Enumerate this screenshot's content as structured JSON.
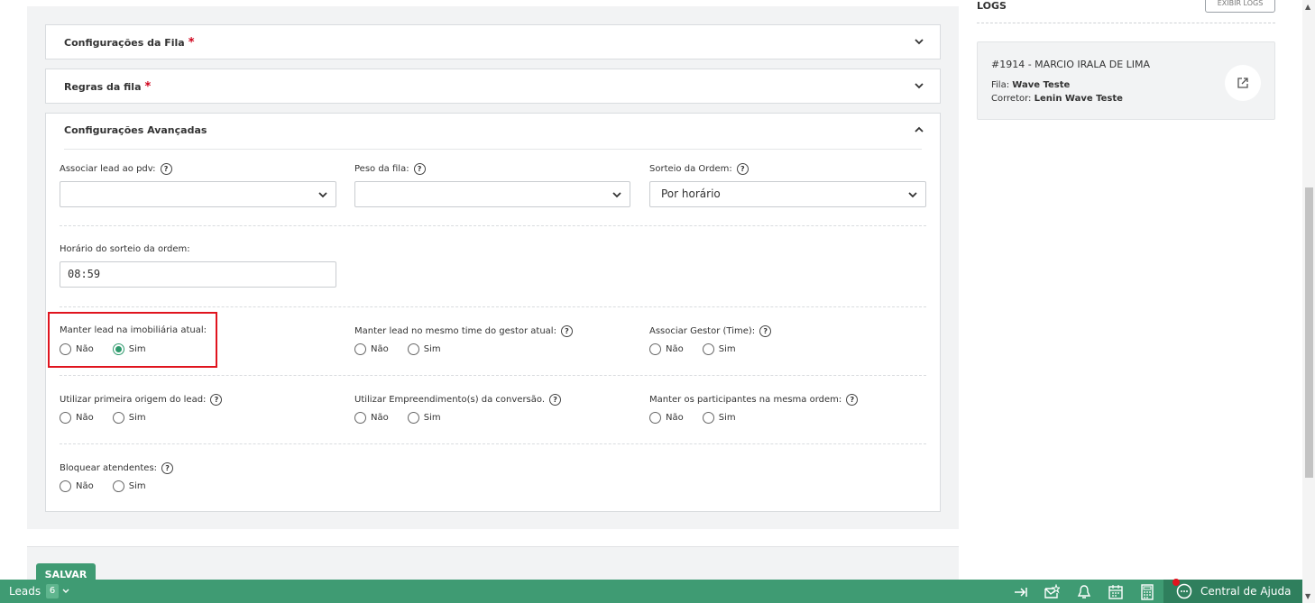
{
  "accordions": {
    "config_fila": {
      "title": "Configurações da Fila",
      "required": "*"
    },
    "regras_fila": {
      "title": "Regras da fila",
      "required": "*"
    },
    "avancadas": {
      "title": "Configurações Avançadas"
    }
  },
  "fields": {
    "associar_lead_pdv": {
      "label": "Associar lead ao pdv:",
      "value": ""
    },
    "peso_fila": {
      "label": "Peso da fila:",
      "value": ""
    },
    "sorteio_ordem": {
      "label": "Sorteio da Ordem:",
      "value": "Por horário"
    },
    "horario_sorteio": {
      "label": "Horário do sorteio da ordem:",
      "value": "08:59"
    }
  },
  "radios": {
    "manter_imobiliaria": {
      "label": "Manter lead na imobiliária atual:",
      "selected": "Sim"
    },
    "manter_time_gestor": {
      "label": "Manter lead no mesmo time do gestor atual:",
      "selected": null
    },
    "associar_gestor": {
      "label": "Associar Gestor (Time):",
      "selected": null
    },
    "primeira_origem": {
      "label": "Utilizar primeira origem do lead:",
      "selected": null
    },
    "empreendimentos": {
      "label": "Utilizar Empreendimento(s) da conversão.",
      "selected": null
    },
    "mesma_ordem": {
      "label": "Manter os participantes na mesma ordem:",
      "selected": null
    },
    "bloquear": {
      "label": "Bloquear atendentes:",
      "selected": null
    }
  },
  "options": {
    "no": "Não",
    "yes": "Sim"
  },
  "help_glyph": "?",
  "save_label": "SALVAR",
  "logs": {
    "title": "LOGS",
    "button": "EXIBIR LOGS",
    "card": {
      "title": "#1914 - MARCIO IRALA DE LIMA",
      "fila_label": "Fila:",
      "fila_value": "Wave Teste",
      "corretor_label": "Corretor:",
      "corretor_value": "Lenin Wave Teste"
    }
  },
  "bottom_bar": {
    "leads_label": "Leads",
    "leads_count": "6",
    "help_center": "Central de Ajuda"
  },
  "colors": {
    "accent": "#3f9b73",
    "accent_dark": "#2f7f5d",
    "highlight": "#e0141e",
    "required": "#d0021b"
  }
}
